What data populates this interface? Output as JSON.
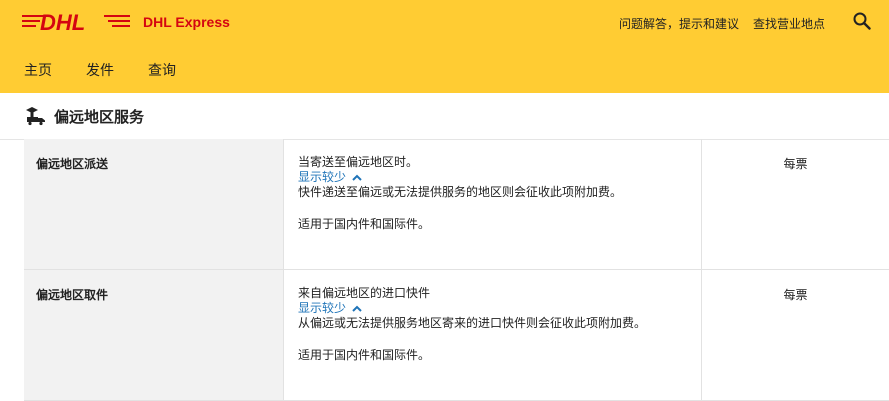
{
  "header": {
    "brand": "DHL Express",
    "links": [
      "问题解答，提示和建议",
      "查找营业地点"
    ],
    "colors": {
      "yellow": "#ffcc33",
      "red": "#d40511",
      "link": "#1f74b8"
    }
  },
  "nav": {
    "items": [
      "主页",
      "发件",
      "查询"
    ]
  },
  "section": {
    "title": "偏远地区服务"
  },
  "rows": [
    {
      "name": "偏远地区派送",
      "summary": "当寄送至偏远地区时。",
      "toggle_label": "显示较少",
      "detail": "快件递送至偏远或无法提供服务的地区则会征收此项附加费。",
      "note": "适用于国内件和国际件。",
      "unit": "每票"
    },
    {
      "name": "偏远地区取件",
      "summary": "来自偏远地区的进口快件",
      "toggle_label": "显示较少",
      "detail": "从偏远或无法提供服务地区寄来的进口快件则会征收此项附加费。",
      "note": "适用于国内件和国际件。",
      "unit": "每票"
    }
  ]
}
